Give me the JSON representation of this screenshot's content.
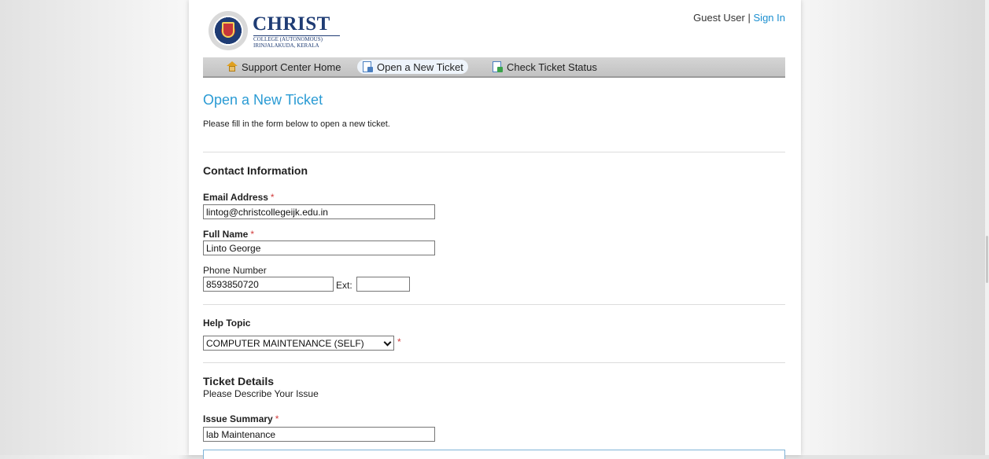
{
  "header": {
    "brand": {
      "name": "CHRIST",
      "sub1": "COLLEGE (AUTONOMOUS)",
      "sub2": "IRINJALAKUDA, KERALA"
    },
    "user": {
      "guest_label": "Guest User",
      "separator": "|",
      "sign_in_label": "Sign In"
    }
  },
  "nav": {
    "items": [
      {
        "label": "Support Center Home",
        "icon": "home-icon",
        "active": false
      },
      {
        "label": "Open a New Ticket",
        "icon": "new-ticket-icon",
        "active": true
      },
      {
        "label": "Check Ticket Status",
        "icon": "ticket-status-icon",
        "active": false
      }
    ]
  },
  "page": {
    "title": "Open a New Ticket",
    "intro": "Please fill in the form below to open a new ticket."
  },
  "contact": {
    "section_title": "Contact Information",
    "email": {
      "label": "Email Address",
      "required": "*",
      "value": "lintog@christcollegeijk.edu.in"
    },
    "full_name": {
      "label": "Full Name",
      "required": "*",
      "value": "Linto George"
    },
    "phone": {
      "label": "Phone Number",
      "value": "8593850720",
      "ext_label": "Ext:",
      "ext_value": ""
    }
  },
  "help_topic": {
    "label": "Help Topic",
    "selected": "COMPUTER MAINTENANCE (SELF)",
    "required": "*"
  },
  "ticket_details": {
    "section_title": "Ticket Details",
    "subtitle": "Please Describe Your Issue",
    "issue_summary": {
      "label": "Issue Summary",
      "required": "*",
      "value": "lab Maintenance"
    }
  },
  "colors": {
    "accent": "#2a9bd4",
    "link": "#1b8fd0",
    "required": "#d23c3c",
    "brand": "#1f3c74"
  }
}
